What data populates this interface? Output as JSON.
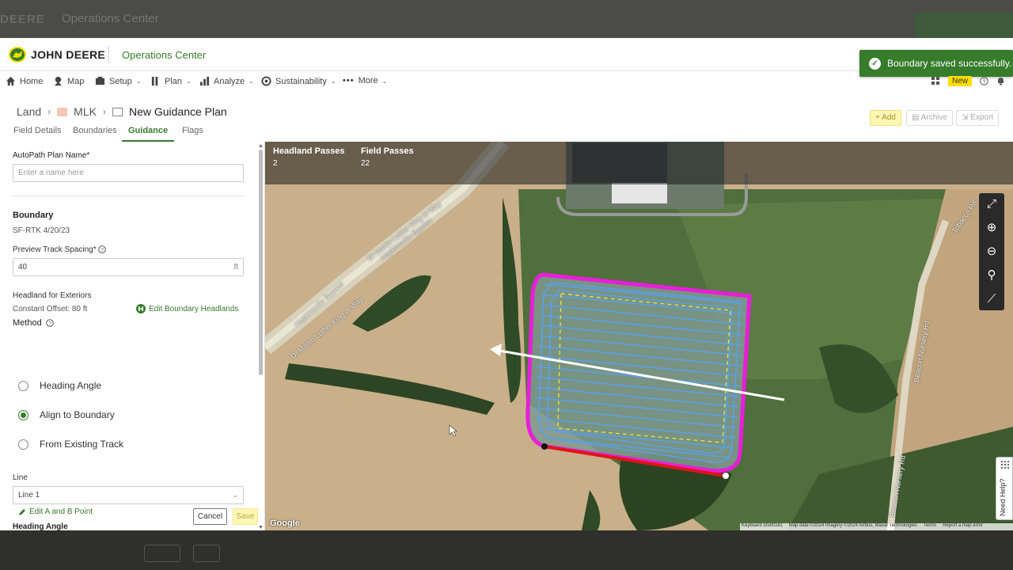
{
  "frame": {
    "ghost_brand": "DEERE",
    "ghost_title": "Operations Center"
  },
  "header": {
    "brand": "JOHN DEERE",
    "app_title": "Operations Center",
    "toast": "Boundary saved successfully."
  },
  "nav": {
    "items": [
      "Home",
      "Map",
      "Setup",
      "Plan",
      "Analyze",
      "Sustainability",
      "More"
    ],
    "new_badge": "New"
  },
  "breadcrumb": {
    "land": "Land",
    "field": "MLK",
    "plan": "New Guidance Plan"
  },
  "tabs": [
    "Field Details",
    "Boundaries",
    "Guidance",
    "Flags"
  ],
  "actions": {
    "add": "+ Add",
    "archive": "Archive",
    "export": "Export"
  },
  "form": {
    "plan_name_label": "AutoPath Plan Name*",
    "plan_name_placeholder": "Enter a name here",
    "boundary_heading": "Boundary",
    "boundary_value": "SF-RTK 4/20/23",
    "spacing_label": "Preview Track Spacing*",
    "spacing_value": "40",
    "spacing_unit": "ft",
    "headland_label": "Headland for Exteriors",
    "headland_value": "Constant Offset: 80 ft",
    "edit_headlands": "Edit Boundary Headlands",
    "method_label": "Method",
    "methods": [
      {
        "label": "Heading Angle",
        "selected": false
      },
      {
        "label": "Align to Boundary",
        "selected": true
      },
      {
        "label": "From Existing Track",
        "selected": false
      }
    ],
    "line_label": "Line",
    "line_value": "Line 1",
    "edit_ab": "Edit A and B Point",
    "heading_angle_label": "Heading Angle",
    "cancel": "Cancel",
    "save": "Save"
  },
  "map": {
    "headland_passes_label": "Headland Passes",
    "headland_passes_value": "2",
    "field_passes_label": "Field Passes",
    "field_passes_value": "22",
    "roads": [
      "Hopkinsville Bypass",
      "Dr Martin Luther King Jr Way",
      "Beacon Nursery Rd",
      "Tobacco Rd"
    ],
    "google": "Google",
    "attribution": [
      "Keyboard shortcuts",
      "Map data ©2024 Imagery ©2024 Airbus, Maxar Technologies",
      "Terms",
      "Report a map error"
    ],
    "need_help": "Need Help?",
    "colors": {
      "boundary": "#e81ed9",
      "tracks": "#5aa0e6",
      "headland_line": "#e8e03a",
      "ab_line": "#e01414"
    }
  }
}
